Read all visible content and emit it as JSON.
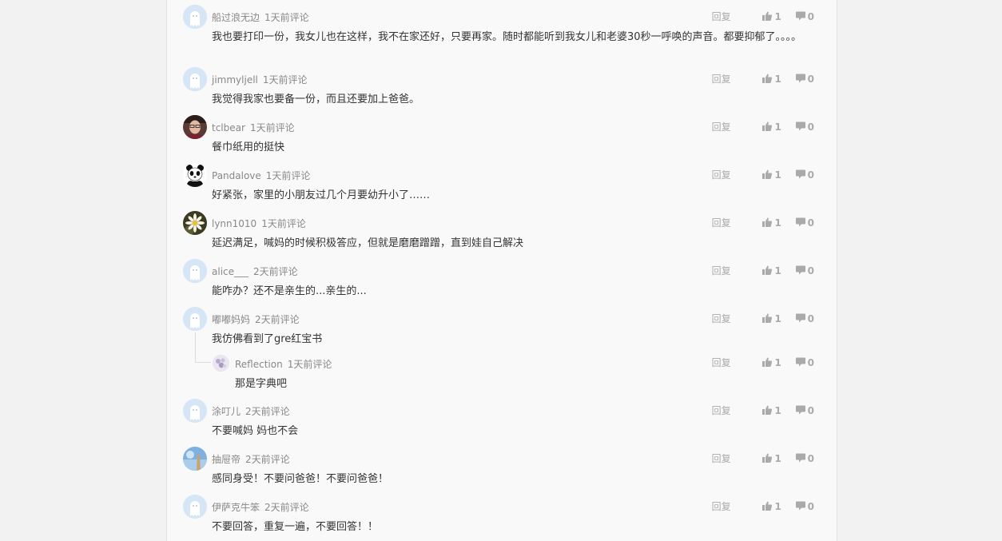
{
  "labels": {
    "reply": "回复"
  },
  "comments": [
    {
      "user": "船过浪无边",
      "time": "1天前评论",
      "text": "我也要打印一份，我女儿也在这样，我不在家还好，只要再家。随时都能听到我女儿和老婆30秒一呼唤的声音。都要抑郁了。。。。",
      "likes": "1",
      "dislikes": "0",
      "avatar": "ghost-avatar"
    },
    {
      "user": "jimmyljell",
      "time": "1天前评论",
      "text": "我觉得我家也要备一份，而且还要加上爸爸。",
      "likes": "1",
      "dislikes": "0",
      "avatar": "ghost-avatar"
    },
    {
      "user": "tclbear",
      "time": "1天前评论",
      "text": "餐巾纸用的挺快",
      "likes": "1",
      "dislikes": "0",
      "avatar": "person-photo-avatar"
    },
    {
      "user": "Pandalove",
      "time": "1天前评论",
      "text": "好紧张，家里的小朋友过几个月要幼升小了……",
      "likes": "1",
      "dislikes": "0",
      "avatar": "panda-avatar"
    },
    {
      "user": "lynn1010",
      "time": "1天前评论",
      "text": "延迟满足，喊妈的时候积极答应，但就是磨磨蹭蹭，直到娃自己解决",
      "likes": "1",
      "dislikes": "0",
      "avatar": "flower-avatar"
    },
    {
      "user": "alice___",
      "time": "2天前评论",
      "text": "能咋办？还不是亲生的...亲生的...",
      "likes": "1",
      "dislikes": "0",
      "avatar": "ghost-avatar"
    },
    {
      "user": "嘟嘟妈妈",
      "time": "2天前评论",
      "text": "我仿佛看到了gre红宝书",
      "likes": "1",
      "dislikes": "0",
      "avatar": "ghost-avatar"
    },
    {
      "user": "涂叮儿",
      "time": "2天前评论",
      "text": "不要喊妈 妈也不会",
      "likes": "1",
      "dislikes": "0",
      "avatar": "ghost-avatar"
    },
    {
      "user": "抽屉帝",
      "time": "2天前评论",
      "text": "感同身受！不要问爸爸！不要问爸爸！",
      "likes": "1",
      "dislikes": "0",
      "avatar": "sky-photo-avatar"
    },
    {
      "user": "伊萨克牛笨",
      "time": "2天前评论",
      "text": "不要回答，重复一遍，不要回答！！",
      "likes": "1",
      "dislikes": "0",
      "avatar": "ghost-avatar"
    }
  ],
  "nested_reply": {
    "user": "Reflection",
    "time": "1天前评论",
    "text": "那是字典吧",
    "likes": "1",
    "dislikes": "0",
    "avatar": "lavender-avatar"
  },
  "colors": {
    "panel": "#f9f9f9",
    "page": "#f2f2f2",
    "muted": "#aaaaaa",
    "ghost_avatar": "#d7e6f6"
  }
}
